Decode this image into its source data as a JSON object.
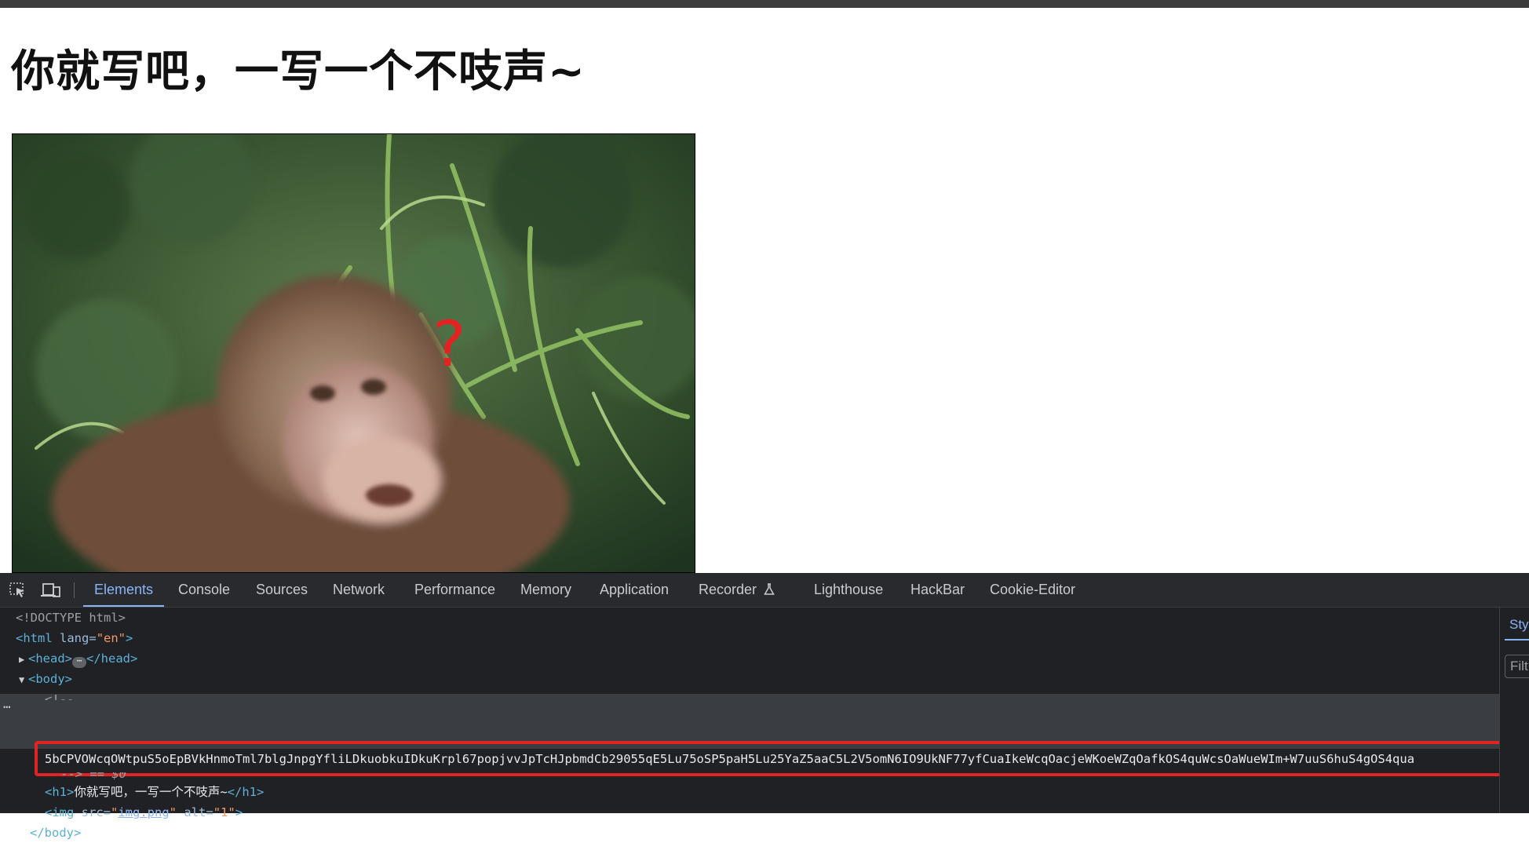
{
  "page": {
    "heading": "你就写吧，一写一个不吱声~",
    "image_question_mark": "?"
  },
  "devtools": {
    "tabs": [
      "Elements",
      "Console",
      "Sources",
      "Network",
      "Performance",
      "Memory",
      "Application",
      "Recorder",
      "Lighthouse",
      "HackBar",
      "Cookie-Editor"
    ],
    "active_tab": "Elements",
    "icons": [
      "inspect-element-icon",
      "device-toolbar-icon",
      "flask-icon"
    ],
    "styles_tab_label": "Sty",
    "filter_placeholder": "Filt",
    "dom": {
      "doctype": "<!DOCTYPE html>",
      "html_open_tag": "<html",
      "html_lang_attr": "lang",
      "html_lang_value": "\"en\"",
      "html_close_bracket": ">",
      "head_open": "<head>",
      "head_close": "</head>",
      "head_ellipsis": "⋯",
      "body_open": "<body>",
      "comment_open_partial": "<!--",
      "selected_text": "5bCPVOWcqOWtpuS5oEpBVkHnmoTml7blgJnpgYfliLDkuobkuIDkuKrpl67popjvvJpTcHJpbmdCb29055qE5Lu75oSP5paH5Lu25YaZ5aaC5L2V5omN6IO9UkNF77yfCuaIkeWcqOacjeWKoeWZqOafkOS4quWcsOaWueWIm+W7uuS6huS4gOS4qua",
      "comment_close": "-->",
      "dollar_zero": "== $0",
      "h1_open": "<h1>",
      "h1_text": "你就写吧，一写一个不吱声~",
      "h1_close": "</h1>",
      "img_open": "<img",
      "img_src_attr": "src=",
      "img_src_quote": "\"",
      "img_src_value": "img.png",
      "img_alt_attr": "alt=",
      "img_alt_value": "\"1\"",
      "img_close_bracket": ">",
      "body_close": "</body>"
    }
  },
  "colors": {
    "devtools_bg": "#202124",
    "tag": "#5db0d7",
    "attr_value": "#f29766",
    "highlight_border": "#e02424",
    "active_tab": "#8ab4f8"
  }
}
